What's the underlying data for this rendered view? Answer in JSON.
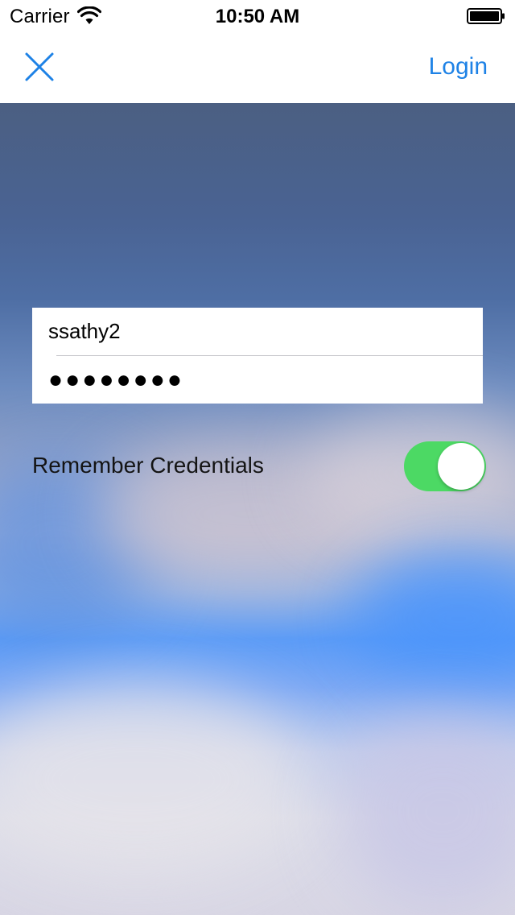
{
  "status_bar": {
    "carrier": "Carrier",
    "time": "10:50 AM",
    "wifi_icon": "wifi-icon",
    "battery_icon": "battery-icon",
    "battery_level": 1.0
  },
  "nav": {
    "close_icon": "close-icon",
    "login_label": "Login",
    "accent_color": "#1e82e6"
  },
  "form": {
    "username_value": "ssathy2",
    "password_value": "●●●●●●●●"
  },
  "remember": {
    "label": "Remember Credentials",
    "enabled": true,
    "toggle_color": "#4cd964"
  }
}
